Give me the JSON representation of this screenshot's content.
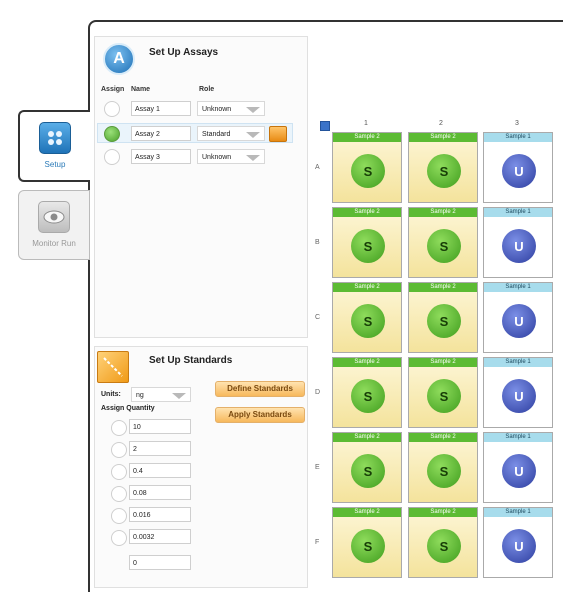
{
  "nav": {
    "setup_label": "Setup",
    "monitor_label": "Monitor Run"
  },
  "assays": {
    "badge": "A",
    "title": "Set Up Assays",
    "headers": {
      "assign": "Assign",
      "name": "Name",
      "role": "Role"
    },
    "rows": [
      {
        "name": "Assay 1",
        "role": "Unknown",
        "selected": false
      },
      {
        "name": "Assay 2",
        "role": "Standard",
        "selected": true
      },
      {
        "name": "Assay 3",
        "role": "Unknown",
        "selected": false
      }
    ]
  },
  "standards": {
    "title": "Set Up Standards",
    "units_label": "Units:",
    "units_value": "ng",
    "assign_quantity_label": "Assign Quantity",
    "define_button": "Define Standards",
    "apply_button": "Apply Standards",
    "quantities": [
      "10",
      "2",
      "0.4",
      "0.08",
      "0.016",
      "0.0032",
      "0"
    ]
  },
  "plate": {
    "columns": [
      "1",
      "2",
      "3"
    ],
    "rows": [
      "A",
      "B",
      "C",
      "D",
      "E",
      "F"
    ],
    "cell_pattern": [
      {
        "sample": "Sample 2",
        "symbol": "S",
        "kind": "standard"
      },
      {
        "sample": "Sample 2",
        "symbol": "S",
        "kind": "standard"
      },
      {
        "sample": "Sample 1",
        "symbol": "U",
        "kind": "unknown"
      }
    ]
  }
}
